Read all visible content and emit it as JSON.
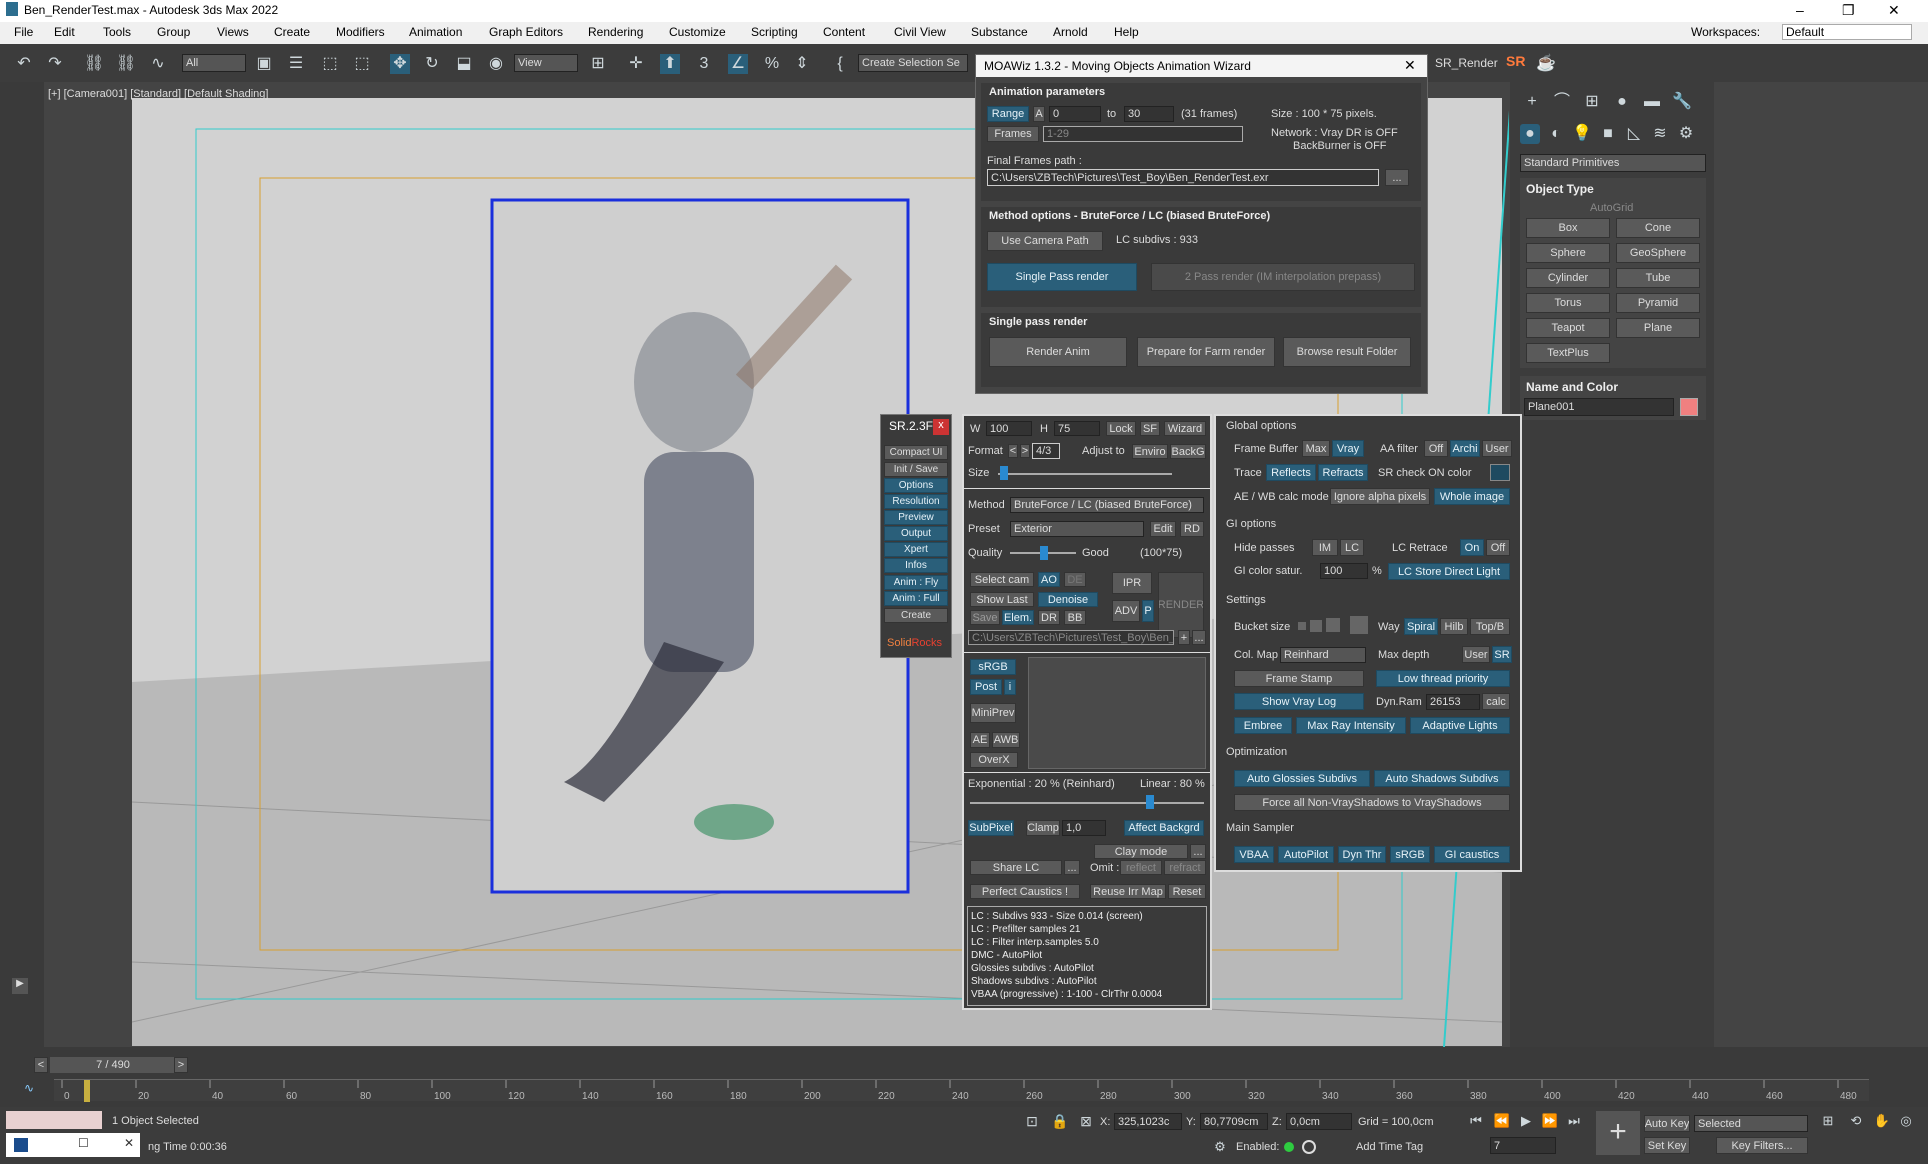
{
  "window": {
    "title": "Ben_RenderTest.max - Autodesk 3ds Max 2022",
    "minimize": "–",
    "maximize": "❐",
    "close": "✕"
  },
  "menu": [
    "File",
    "Edit",
    "Tools",
    "Group",
    "Views",
    "Create",
    "Modifiers",
    "Animation",
    "Graph Editors",
    "Rendering",
    "Customize",
    "Scripting",
    "Content",
    "Civil View",
    "Substance",
    "Arnold",
    "Help"
  ],
  "workspaces": {
    "label": "Workspaces:",
    "value": "Default"
  },
  "toolbar": {
    "filter": "All",
    "view": "View",
    "selection_set": "Create Selection Se",
    "sr_render": "SR_Render",
    "sr_logo": "SR"
  },
  "viewport": {
    "label": "[+] [Camera001] [Standard] [Default Shading]"
  },
  "moawiz": {
    "title": "MOAWiz 1.3.2 - Moving Objects Animation Wizard",
    "anim_header": "Animation parameters",
    "range": "Range",
    "a": "A",
    "from": "0",
    "to_label": "to",
    "to": "30",
    "frames_count": "(31 frames)",
    "size": "Size : 100 * 75 pixels.",
    "frames_btn": "Frames",
    "frames_val": "1-29",
    "network1": "Network : Vray DR is OFF",
    "network2": "BackBurner is OFF",
    "final_label": "Final Frames path :",
    "final_path": "C:\\Users\\ZBTech\\Pictures\\Test_Boy\\Ben_RenderTest.exr",
    "browse": "...",
    "method_header": "Method options - BruteForce / LC (biased BruteForce)",
    "use_cam": "Use Camera Path",
    "lc_subdivs": "LC subdivs : 933",
    "single_pass": "Single Pass render",
    "two_pass": "2 Pass render (IM interpolation prepass)",
    "single_header": "Single pass render",
    "render_anim": "Render Anim",
    "prepare_farm": "Prepare for Farm render",
    "browse_result": "Browse result Folder"
  },
  "sr_side": {
    "title": "SR.2.3F",
    "close": "x",
    "items": [
      "Compact UI",
      "Init / Save",
      "Options",
      "Resolution",
      "Preview",
      "Output",
      "Xpert",
      "Infos",
      "Anim : Fly",
      "Anim : Full",
      "Create"
    ],
    "brand_a": "Solid",
    "brand_b": "Rocks"
  },
  "sr_main": {
    "w": "W",
    "w_val": "100",
    "h": "H",
    "h_val": "75",
    "lock": "Lock",
    "sf": "SF",
    "wizard": "Wizard",
    "format": "Format",
    "fmt_l": "<",
    "fmt_r": ">",
    "format_val": "4/3",
    "adjust": "Adjust to",
    "enviro": "Enviro",
    "backg": "BackG",
    "size": "Size",
    "method": "Method",
    "method_val": "BruteForce / LC (biased BruteForce)",
    "preset": "Preset",
    "preset_val": "Exterior",
    "edit": "Edit",
    "rd": "RD",
    "quality": "Quality",
    "good": "Good",
    "res": "(100*75)",
    "select_cam": "Select cam",
    "ao": "AO",
    "de": "DE",
    "ipr": "IPR",
    "show_last": "Show Last",
    "denoise": "Denoise",
    "render": "RENDER",
    "save": "Save",
    "elem": "Elem.",
    "dr": "DR",
    "bb": "BB",
    "adv": "ADV",
    "p": "P",
    "out_path": "C:\\Users\\ZBTech\\Pictures\\Test_Boy\\Ben_",
    "plus": "+",
    "dots": "...",
    "srgb": "sRGB",
    "post": "Post",
    "i": "i",
    "miniprev": "MiniPrev",
    "ae": "AE",
    "awb": "AWB",
    "overx": "OverX",
    "exponential": "Exponential : 20 % (Reinhard)",
    "linear": "Linear : 80 %",
    "subpixel": "SubPixel",
    "clamp": "Clamp",
    "clamp_val": "1,0",
    "affect": "Affect Backgrd",
    "clay": "Clay mode",
    "share_lc": "Share LC",
    "omit": "Omit :",
    "reflect": "reflect",
    "refract": "refract",
    "caustics": "Perfect Caustics !",
    "reuse": "Reuse Irr Map",
    "reset": "Reset",
    "log": [
      "LC : Subdivs 933 - Size 0.014 (screen)",
      "LC : Prefilter samples 21",
      "LC : Filter interp.samples  5.0",
      "DMC - AutoPilot",
      "Glossies subdivs : AutoPilot",
      "Shadows subdivs : AutoPilot",
      "VBAA (progressive) : 1-100 - ClrThr 0.0004"
    ]
  },
  "sr_opts": {
    "global": "Global options",
    "frame_buffer": "Frame Buffer",
    "max": "Max",
    "vray": "Vray",
    "aa_filter": "AA filter",
    "off": "Off",
    "archi": "Archi",
    "user": "User",
    "trace": "Trace",
    "reflects": "Reflects",
    "refracts": "Refracts",
    "sr_check": "SR check ON color",
    "ae_wb": "AE / WB calc mode",
    "ignore_alpha": "Ignore alpha pixels",
    "whole": "Whole image",
    "gi": "GI options",
    "hide_passes": "Hide passes",
    "im": "IM",
    "lc": "LC",
    "lc_retrace": "LC Retrace",
    "on": "On",
    "off2": "Off",
    "gi_color": "GI color satur.",
    "gi_val": "100",
    "pct": "%",
    "lc_store": "LC Store Direct Light",
    "settings": "Settings",
    "bucket": "Bucket size",
    "way": "Way",
    "spiral": "Spiral",
    "hilb": "Hilb",
    "topb": "Top/B",
    "colmap": "Col. Map",
    "colmap_val": "Reinhard",
    "max_depth": "Max depth",
    "user2": "User",
    "sr": "SR",
    "frame_stamp": "Frame Stamp",
    "low_thread": "Low thread priority",
    "show_log": "Show Vray Log",
    "dynram": "Dyn.Ram",
    "dynram_val": "26153",
    "calc": "calc",
    "embree": "Embree",
    "max_ray": "Max Ray Intensity",
    "adaptive": "Adaptive Lights",
    "optim": "Optimization",
    "auto_gloss": "Auto Glossies Subdivs",
    "auto_shadow": "Auto Shadows Subdivs",
    "force": "Force all Non-VrayShadows to VrayShadows",
    "sampler": "Main Sampler",
    "vbaa": "VBAA",
    "autopilot": "AutoPilot",
    "dynthr": "Dyn Thr",
    "srgb": "sRGB",
    "gi_caustics": "GI caustics"
  },
  "cmd": {
    "dropdown": "Standard Primitives",
    "object_type": "Object Type",
    "autogrid": "AutoGrid",
    "prims": [
      "Box",
      "Cone",
      "Sphere",
      "GeoSphere",
      "Cylinder",
      "Tube",
      "Torus",
      "Pyramid",
      "Teapot",
      "Plane",
      "TextPlus"
    ],
    "name_color": "Name and Color",
    "object_name": "Plane001",
    "object_color": "#f08080"
  },
  "timeline": {
    "frame": "7 / 490",
    "ticks": [
      "0",
      "20",
      "40",
      "60",
      "80",
      "100",
      "120",
      "140",
      "160",
      "180",
      "200",
      "220",
      "240",
      "260",
      "280",
      "300",
      "320",
      "340",
      "360",
      "380",
      "400",
      "420",
      "440",
      "460",
      "480"
    ],
    "prev": "<",
    "next": ">"
  },
  "status": {
    "selected": "1 Object Selected",
    "time": "ng Time  0:00:36",
    "x_label": "X:",
    "x": "325,1023c",
    "y_label": "Y:",
    "y": "80,7709cm",
    "z_label": "Z:",
    "z": "0,0cm",
    "grid": "Grid = 100,0cm",
    "enabled": "Enabled:",
    "add_tag": "Add Time Tag",
    "auto_key": "Auto Key",
    "set_key": "Set Key",
    "key_mode": "Selected",
    "key_filters": "Key Filters...",
    "frame": "7"
  }
}
